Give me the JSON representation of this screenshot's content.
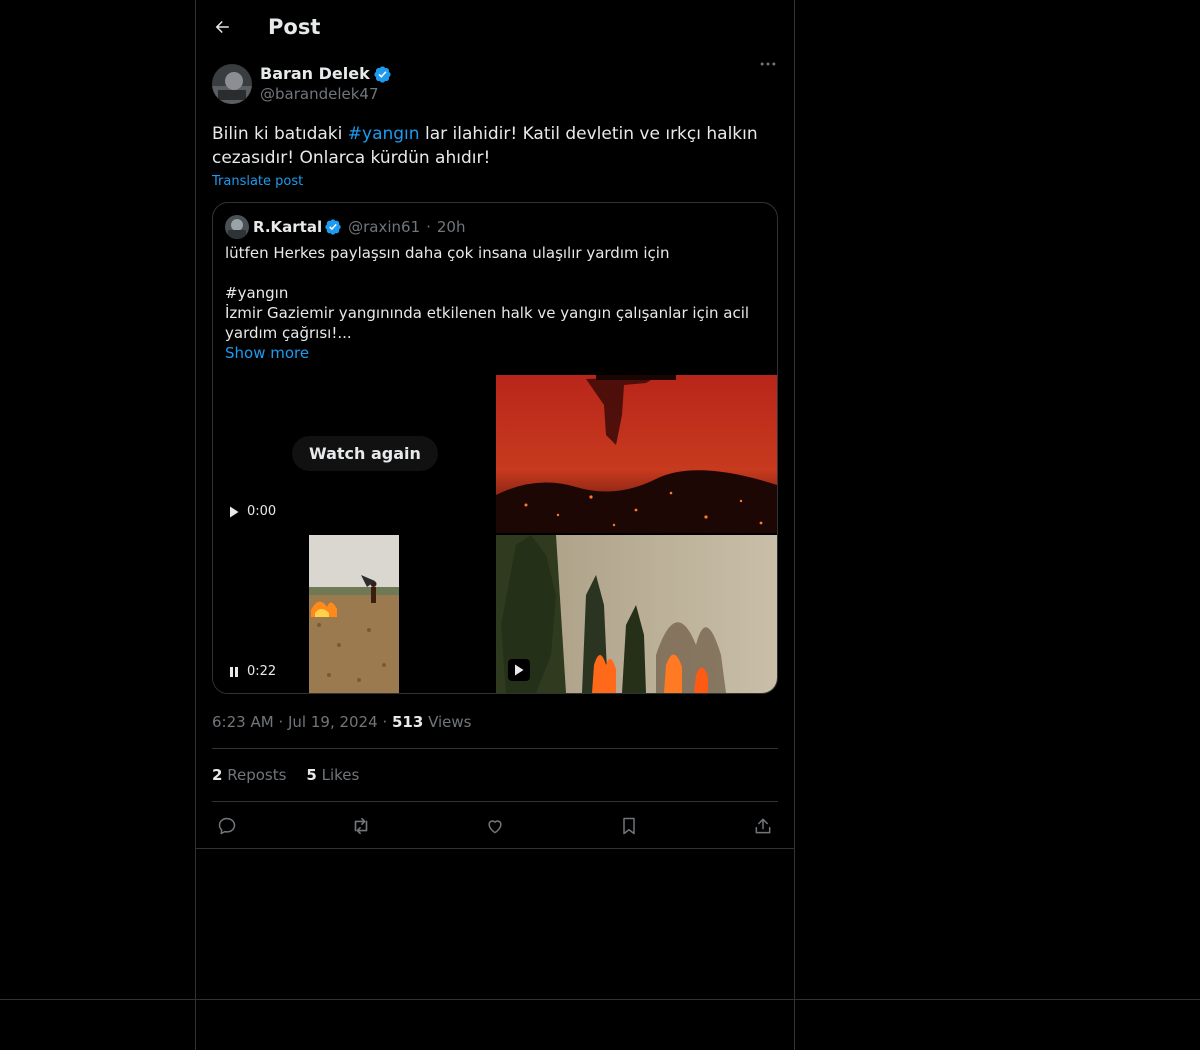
{
  "header": {
    "title": "Post",
    "back_icon": "arrow-left-icon"
  },
  "post": {
    "author": {
      "name": "Baran Delek",
      "handle": "@barandelek47",
      "verified": true
    },
    "text_before": "Bilin ki batıdaki ",
    "hashtag": "#yangın",
    "text_after": " lar ilahidir! Katil devletin ve ırkçı halkın cezasıdır! Onlarca kürdün ahıdır!",
    "translate_label": "Translate post",
    "quote": {
      "author": {
        "name": "R.Kartal",
        "handle": "@raxin61",
        "time": "20h",
        "verified": true
      },
      "lines": [
        "lütfen Herkes paylaşsın daha çok insana ulaşılır yardım için",
        "",
        "#yangın",
        "İzmir Gaziemir yangınında etkilenen halk ve yangın çalışanlar için acil yardım çağrısı!..."
      ],
      "show_more": "Show more",
      "media": {
        "watch_again": "Watch again",
        "video1_time": "0:00",
        "video2_time": "0:22"
      }
    },
    "meta": {
      "time": "6:23 AM",
      "date": "Jul 19, 2024",
      "views_count": "513",
      "views_label": "Views"
    },
    "stats": {
      "reposts_count": "2",
      "reposts_label": "Reposts",
      "likes_count": "5",
      "likes_label": "Likes"
    },
    "actions": [
      "reply-icon",
      "repost-icon",
      "like-icon",
      "bookmark-icon",
      "share-icon"
    ]
  },
  "colors": {
    "background": "#000000",
    "text": "#e7e9ea",
    "muted": "#71767b",
    "accent": "#1d9bf0",
    "border": "#2f3336"
  }
}
